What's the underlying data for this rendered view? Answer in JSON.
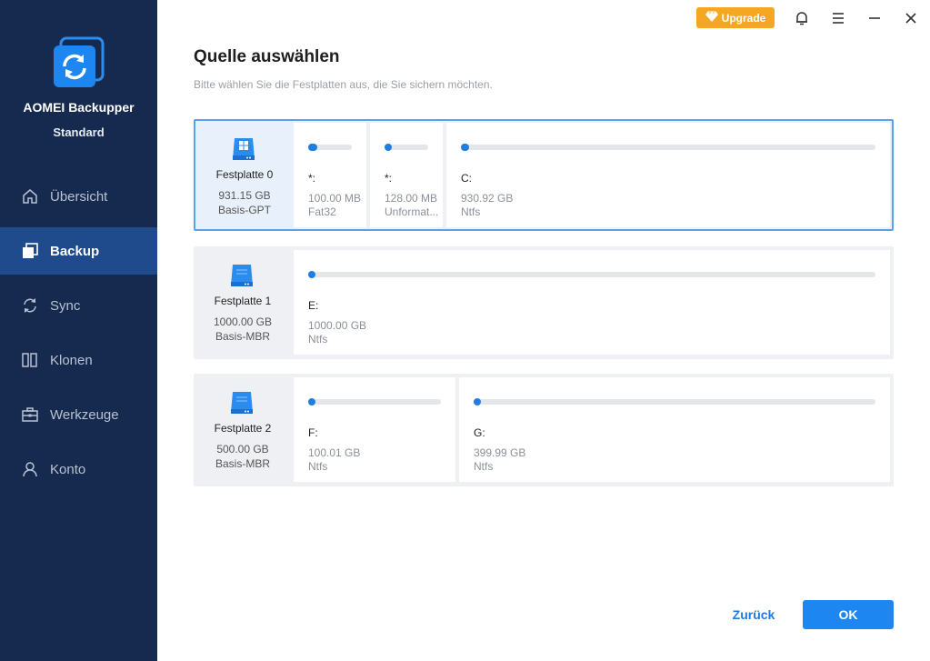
{
  "app": {
    "name": "AOMEI Backupper",
    "edition": "Standard"
  },
  "titlebar": {
    "upgrade_label": "Upgrade"
  },
  "nav": [
    {
      "label": "Übersicht",
      "icon": "home-icon",
      "active": false
    },
    {
      "label": "Backup",
      "icon": "backup-icon",
      "active": true
    },
    {
      "label": "Sync",
      "icon": "sync-icon",
      "active": false
    },
    {
      "label": "Klonen",
      "icon": "clone-icon",
      "active": false
    },
    {
      "label": "Werkzeuge",
      "icon": "toolbox-icon",
      "active": false
    },
    {
      "label": "Konto",
      "icon": "user-icon",
      "active": false
    }
  ],
  "main": {
    "title": "Quelle auswählen",
    "subtitle": "Bitte wählen Sie die Festplatten aus, die Sie sichern möchten."
  },
  "disks": [
    {
      "name": "Festplatte 0",
      "size": "931.15 GB",
      "type": "Basis-GPT",
      "selected": true,
      "icon": "windows-disk-icon",
      "partitions": [
        {
          "letter": "*:",
          "size": "100.00 MB",
          "fs": "Fat32",
          "used_fraction": 0.2
        },
        {
          "letter": "*:",
          "size": "128.00 MB",
          "fs": "Unformat...",
          "used_fraction": 0.05
        },
        {
          "letter": "C:",
          "size": "930.92 GB",
          "fs": "Ntfs",
          "used_fraction": 0.02
        }
      ]
    },
    {
      "name": "Festplatte 1",
      "size": "1000.00 GB",
      "type": "Basis-MBR",
      "selected": false,
      "icon": "disk-icon",
      "partitions": [
        {
          "letter": "E:",
          "size": "1000.00 GB",
          "fs": "Ntfs",
          "used_fraction": 0.005
        }
      ]
    },
    {
      "name": "Festplatte 2",
      "size": "500.00 GB",
      "type": "Basis-MBR",
      "selected": false,
      "icon": "disk-icon",
      "partitions": [
        {
          "letter": "F:",
          "size": "100.01 GB",
          "fs": "Ntfs",
          "used_fraction": 0.02
        },
        {
          "letter": "G:",
          "size": "399.99 GB",
          "fs": "Ntfs",
          "used_fraction": 0.008
        }
      ]
    }
  ],
  "footer": {
    "back_label": "Zurück",
    "ok_label": "OK"
  },
  "colors": {
    "sidebar": "#162a4f",
    "active_nav": "#1f4a8c",
    "accent": "#1e86f0",
    "upgrade": "#f5a623"
  }
}
